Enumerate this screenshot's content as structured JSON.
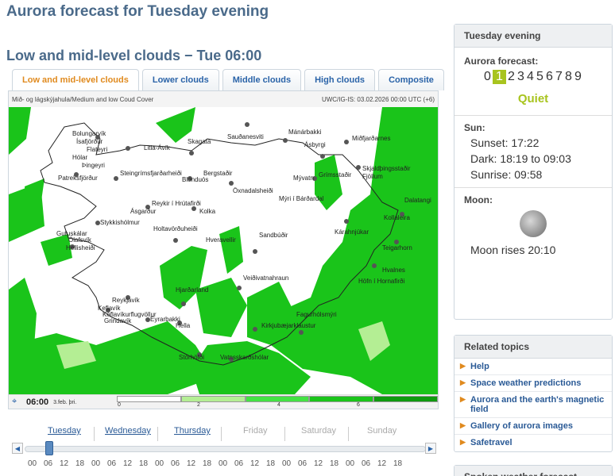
{
  "page_title": "Aurora forecast for Tuesday evening",
  "section_title": "Low and mid-level clouds − Tue 06:00",
  "tabs": [
    {
      "label": "Low and mid-level clouds",
      "active": true
    },
    {
      "label": "Lower clouds",
      "active": false
    },
    {
      "label": "Middle clouds",
      "active": false
    },
    {
      "label": "High clouds",
      "active": false
    },
    {
      "label": "Composite",
      "active": false
    }
  ],
  "map": {
    "header_left": "Mið- og lágskýjahula/Medium and low Coud Cover",
    "header_right": "UWC/IG-IS: 03.02.2026 00:00 UTC (+6)",
    "places": [
      "Bolungarvík",
      "Ísafjörður",
      "Flateyri",
      "Hólar",
      "Þingeyri",
      "Patreksfjörður",
      "Litla-Ávík",
      "Skagatá",
      "Sauðanesviti",
      "Mánárbakki",
      "Ásbyrgi",
      "Miðfjarðarnes",
      "Steingrímsfjarðarheiði",
      "Bergstaðir",
      "Blönduós",
      "Skjaldþingsstaðir",
      "Grímsstaðir",
      "Fjöllum",
      "Öxnadalsheiði",
      "Mývatn",
      "Mýri í Bárðardal",
      "Dalatangi",
      "Ásgarður",
      "Reykir í Hrútafirði",
      "Kolka",
      "Kollaleira",
      "Stykkishólmur",
      "Holtavörðuheiði",
      "Kárahnjúkar",
      "Gufuskálar",
      "Ólafsvík",
      "Hellisheiði",
      "Hveravellir",
      "Sandbúðir",
      "Teigarhorn",
      "Veiðivatnahraun",
      "Hvalnes",
      "Höfn í Hornafirði",
      "Reykjavík",
      "Keflavík",
      "Keflavíkurflugvöllur",
      "Hjarðarland",
      "Eyrarbakki",
      "Grindavík",
      "Hella",
      "Kirkjubæjarklaustur",
      "Fagurhólsmýri",
      "Stórhöfði",
      "Vatnsskarðshólar"
    ],
    "time": "06:00",
    "date": "3.feb. þri.",
    "legend_ticks": [
      "0",
      "2",
      "4",
      "6"
    ],
    "legend_colors": [
      "#ffffff",
      "#b4ee94",
      "#44e244",
      "#1ac41a",
      "#0f9a0f"
    ]
  },
  "timeline": {
    "days": [
      {
        "label": "Tuesday",
        "enabled": true
      },
      {
        "label": "Wednesday",
        "enabled": true
      },
      {
        "label": "Thursday",
        "enabled": true
      },
      {
        "label": "Friday",
        "enabled": false
      },
      {
        "label": "Saturday",
        "enabled": false
      },
      {
        "label": "Sunday",
        "enabled": false
      }
    ],
    "hours": [
      "00",
      "06",
      "12",
      "18",
      "00",
      "06",
      "12",
      "18",
      "00",
      "06",
      "12",
      "18",
      "00",
      "06",
      "12",
      "18",
      "00",
      "06",
      "12",
      "18",
      "00",
      "06",
      "12",
      "18"
    ],
    "left_arrow": "◀",
    "right_arrow": "▶"
  },
  "sidebar": {
    "evening_title": "Tuesday evening",
    "aurora_label": "Aurora forecast:",
    "kp_values": [
      "0",
      "1",
      "2",
      "3",
      "4",
      "5",
      "6",
      "7",
      "8",
      "9"
    ],
    "kp_active": "1",
    "activity": "Quiet",
    "sun_label": "Sun:",
    "sunset": "Sunset: 17:22",
    "dark": "Dark: 18:19 to 09:03",
    "sunrise": "Sunrise: 09:58",
    "moon_label": "Moon:",
    "moon_rise": "Moon rises 20:10",
    "related_title": "Related topics",
    "related": [
      "Help",
      "Space weather predictions",
      "Aurora and the earth's magnetic field",
      "Gallery of aurora images",
      "Safetravel"
    ],
    "next_box_title": "Spoken weather forecast"
  },
  "colors": {
    "accent": "#4a6a8a",
    "link": "#2a5a96",
    "active_tab": "#e08a1e",
    "quiet": "#a8c41e"
  }
}
